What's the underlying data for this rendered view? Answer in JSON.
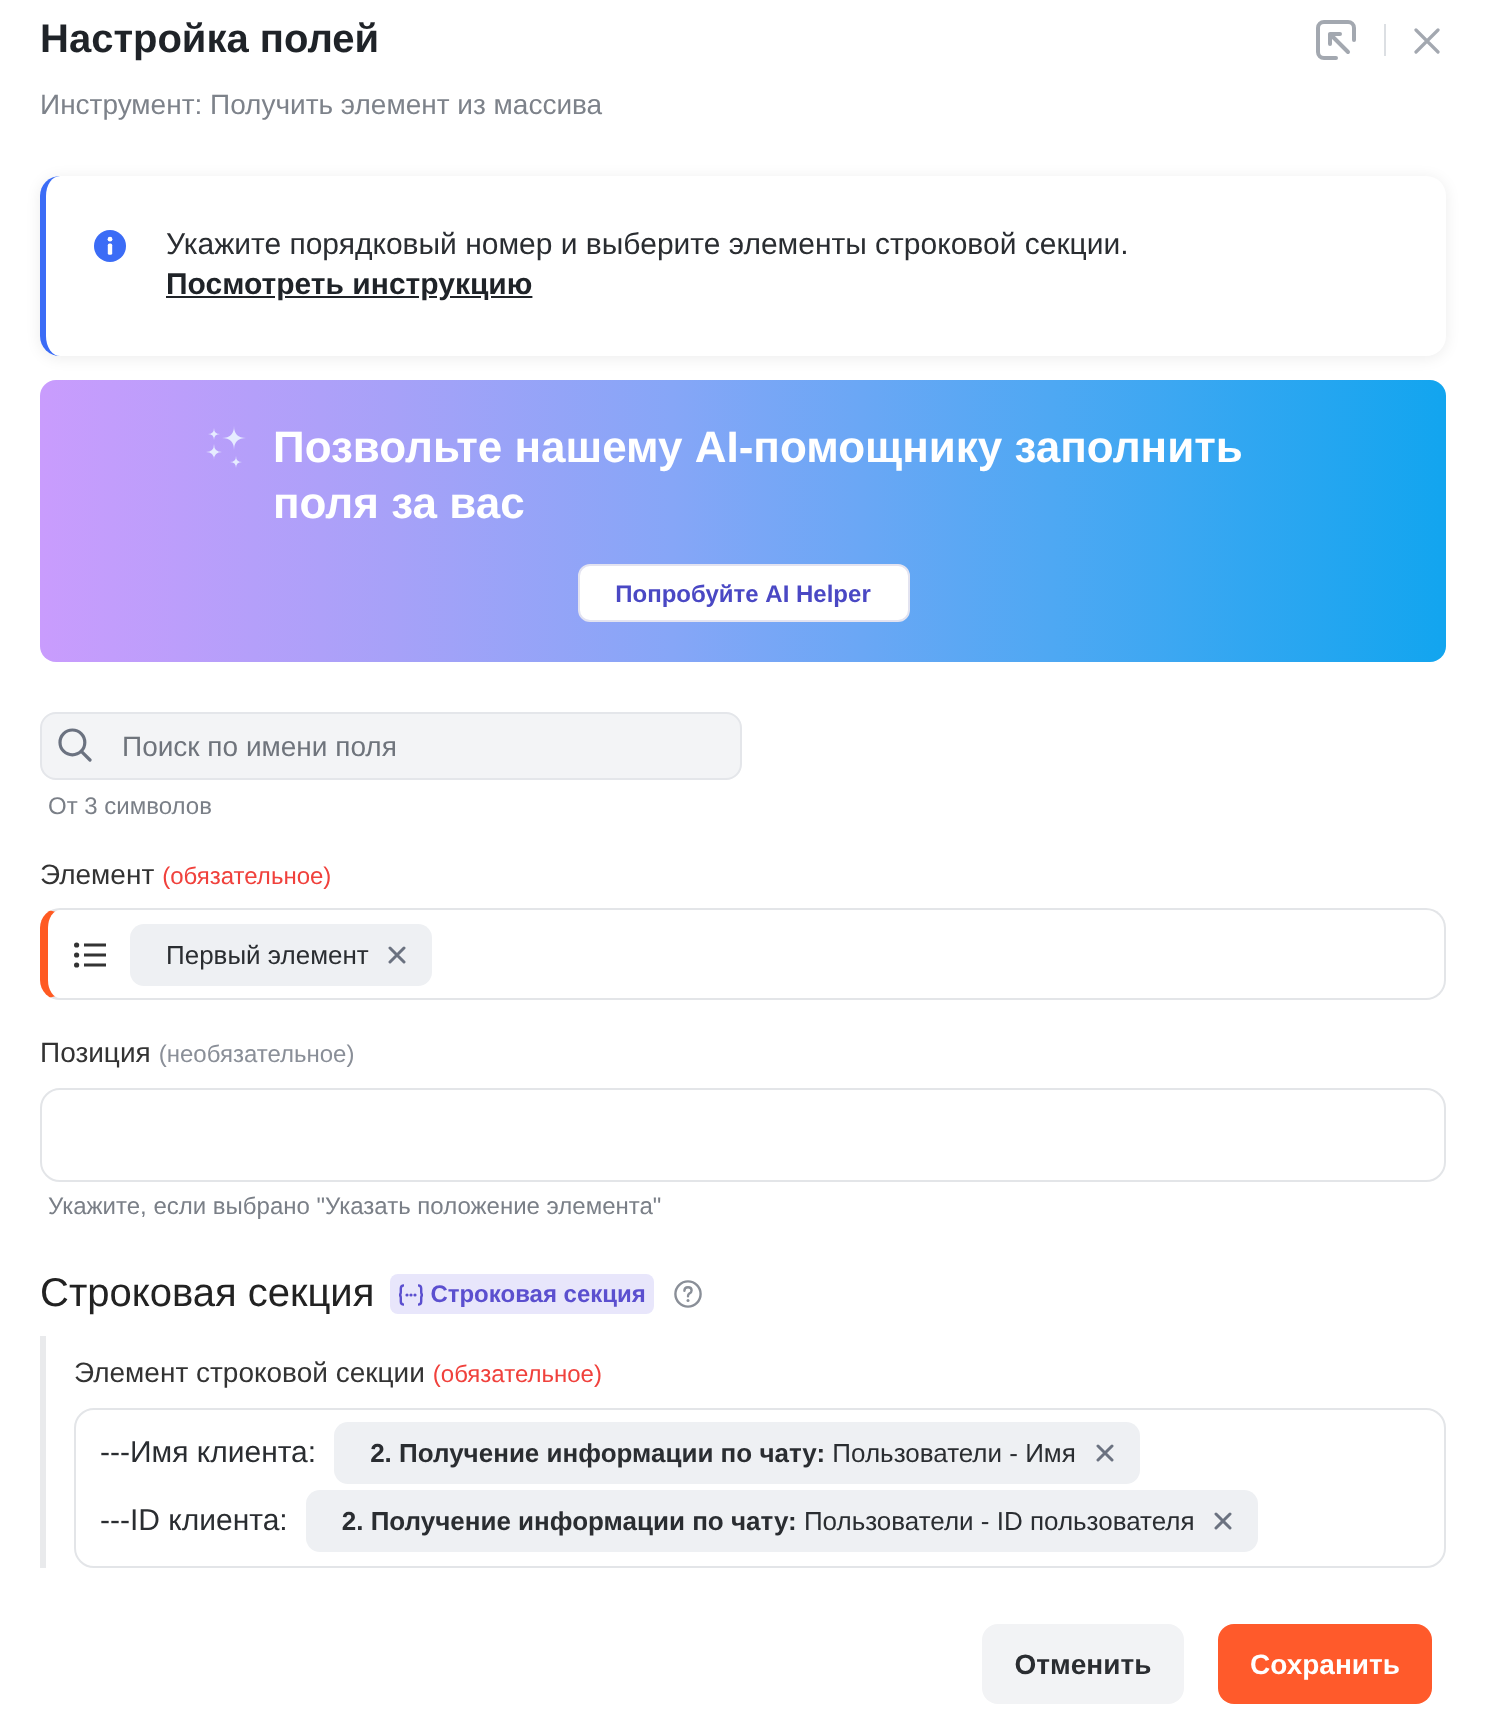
{
  "dialog": {
    "title": "Настройка полей",
    "subtitle": "Инструмент: Получить элемент из массива"
  },
  "info": {
    "text": "Укажите порядковый номер и выберите элементы строковой секции.",
    "link": "Посмотреть инструкцию"
  },
  "ai_banner": {
    "title": "Позвольте нашему AI-помощнику заполнить поля за вас",
    "button": "Попробуйте AI Helper"
  },
  "search": {
    "placeholder": "Поиск по имени поля",
    "hint": "От 3 символов"
  },
  "fields": [
    {
      "kind": "chips",
      "label": "Элемент",
      "requirement": "(обязательное)",
      "required": true,
      "chips": [
        "Первый элемент"
      ]
    },
    {
      "kind": "text",
      "label": "Позиция",
      "requirement": "(необязательное)",
      "required": false,
      "hint": "Укажите, если выбрано \"Указать положение элемента\""
    }
  ],
  "section": {
    "title": "Строковая секция",
    "badge": "Строковая секция",
    "label": "Элемент строковой секции",
    "requirement": "(обязательное)",
    "required": true,
    "rows": [
      {
        "name": "---Имя клиента:",
        "value": "**2. Получение информации по чату:** Пользователи - Имя"
      },
      {
        "name": "---ID клиента:",
        "value": "**2. Получение информации по чату:** Пользователи - ID пользователя"
      }
    ]
  },
  "buttons": [
    {
      "kind": "secondary",
      "label": "Отменить"
    },
    {
      "kind": "primary",
      "label": "Сохранить"
    }
  ]
}
